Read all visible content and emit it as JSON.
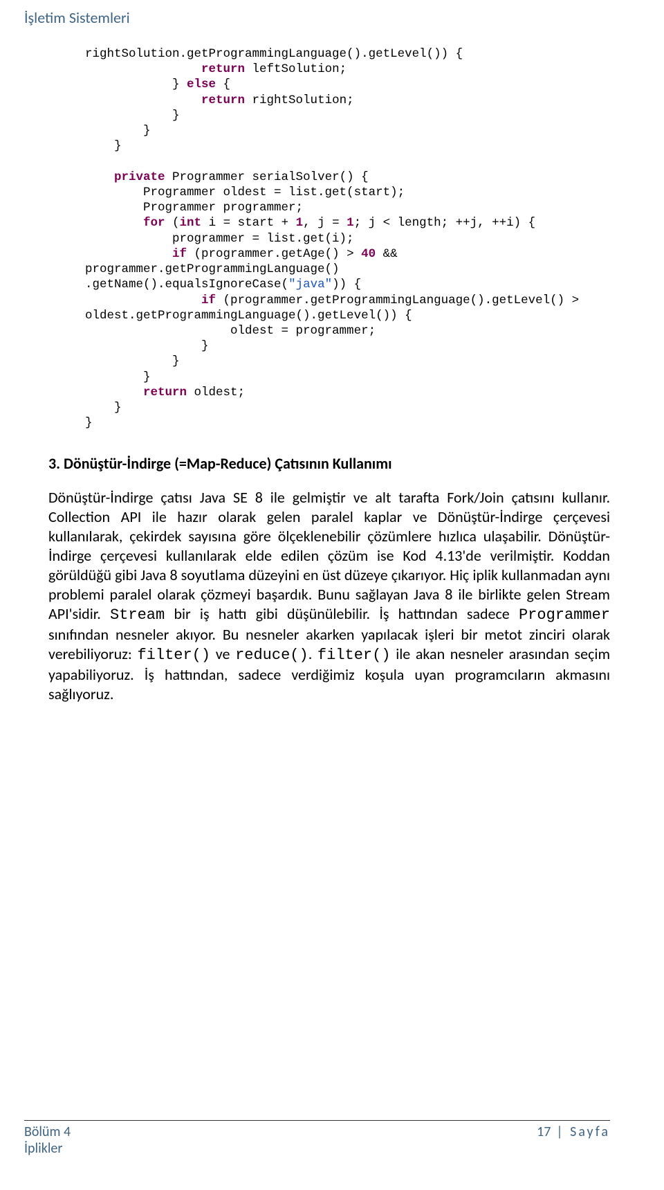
{
  "header": {
    "title": "İşletim Sistemleri"
  },
  "code": {
    "l01a": "rightSolution.getProgrammingLanguage().getLevel()) {",
    "l02a": "return",
    "l02b": " leftSolution;",
    "l03a": "            } ",
    "l03b": "else",
    "l03c": " {",
    "l04a": "return",
    "l04b": " rightSolution;",
    "l05": "            }",
    "l06": "        }",
    "l07": "    }",
    "l08": "",
    "l09a": "    ",
    "l09b": "private",
    "l09c": " Programmer serialSolver() {",
    "l10": "        Programmer oldest = list.get(start);",
    "l11": "        Programmer programmer;",
    "l12a": "        ",
    "l12b": "for",
    "l12c": " (",
    "l12d": "int",
    "l12e": " i = start + ",
    "l12f": "1",
    "l12g": ", j = ",
    "l12h": "1",
    "l12i": "; j < length; ++j, ++i) {",
    "l13": "            programmer = list.get(i);",
    "l14a": "            ",
    "l14b": "if",
    "l14c": " (programmer.getAge() > ",
    "l14d": "40",
    "l14e": " &&",
    "l15": "programmer.getProgrammingLanguage()",
    "l16a": ".getName().equalsIgnoreCase(",
    "l16b": "\"java\"",
    "l16c": ")) {",
    "l17a": "                ",
    "l17b": "if",
    "l17c": " (programmer.getProgrammingLanguage().getLevel() >",
    "l18": "oldest.getProgrammingLanguage().getLevel()) {",
    "l19": "                    oldest = programmer;",
    "l20": "                }",
    "l21": "            }",
    "l22": "        }",
    "l23a": "        ",
    "l23b": "return",
    "l23c": " oldest;",
    "l24": "    }",
    "l25": "}"
  },
  "section": {
    "heading": "3. Dönüştür-İndirge (=Map-Reduce) Çatısının Kullanımı",
    "p_part1": "Dönüştür-İndirge çatısı Java SE 8 ile gelmiştir ve alt tarafta Fork/Join çatısını kullanır. Collection API ile hazır olarak gelen paralel kaplar ve Dönüştür-İndirge çerçevesi kullanılarak, çekirdek sayısına göre ölçeklenebilir çözümlere hızlıca ulaşabilir. Dönüştür-İndirge çerçevesi kullanılarak elde edilen çözüm ise Kod 4.13'de verilmiştir. Koddan görüldüğü gibi Java 8 soyutlama düzeyini en üst düzeye çıkarıyor. Hiç iplik kullanmadan aynı problemi paralel olarak çözmeyi başardık. Bunu sağlayan Java 8 ile birlikte gelen Stream API'sidir. ",
    "mono1": "Stream",
    "p_part2": " bir iş hattı gibi düşünülebilir. İş hattından sadece ",
    "mono2": "Programmer",
    "p_part3": " sınıfından nesneler akıyor. Bu nesneler akarken yapılacak işleri bir metot zinciri olarak verebiliyoruz: ",
    "mono3": "filter()",
    "p_part4": " ve ",
    "mono4": "reduce()",
    "p_part5": ". ",
    "mono5": "filter()",
    "p_part6": " ile akan nesneler arasından seçim yapabiliyoruz. İş hattından, sadece verdiğimiz koşula uyan programcıların akmasını sağlıyoruz."
  },
  "footer": {
    "chapter": "Bölüm 4",
    "subject": "İplikler",
    "page_number": "17",
    "page_label": "Sayfa"
  }
}
